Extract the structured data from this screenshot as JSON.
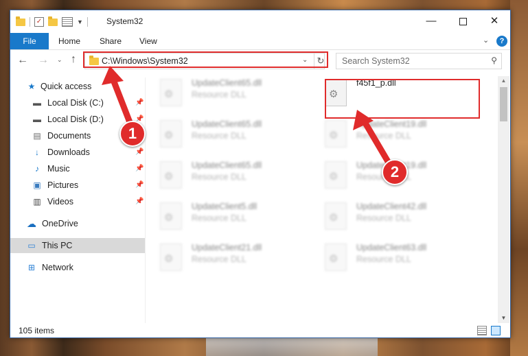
{
  "window": {
    "title": "System32",
    "controls": {
      "minimize": "—",
      "maximize": "",
      "close": "✕"
    }
  },
  "ribbon": {
    "tabs": [
      "File",
      "Home",
      "Share",
      "View"
    ],
    "help": "?"
  },
  "address": {
    "path": "C:\\Windows\\System32"
  },
  "search": {
    "placeholder": "Search System32"
  },
  "sidebar": {
    "items": [
      {
        "label": "Quick access",
        "icon": "star-icon",
        "pinned": false
      },
      {
        "label": "Local Disk (C:)",
        "icon": "drive-icon",
        "pinned": true
      },
      {
        "label": "Local Disk (D:)",
        "icon": "drive-icon",
        "pinned": true
      },
      {
        "label": "Documents",
        "icon": "documents-icon",
        "pinned": true
      },
      {
        "label": "Downloads",
        "icon": "download-icon",
        "pinned": true
      },
      {
        "label": "Music",
        "icon": "music-icon",
        "pinned": true
      },
      {
        "label": "Pictures",
        "icon": "pictures-icon",
        "pinned": true
      },
      {
        "label": "Videos",
        "icon": "videos-icon",
        "pinned": true
      },
      {
        "label": "OneDrive",
        "icon": "cloud-icon",
        "pinned": false
      },
      {
        "label": "This PC",
        "icon": "computer-icon",
        "pinned": false
      },
      {
        "label": "Network",
        "icon": "network-icon",
        "pinned": false
      }
    ]
  },
  "files": [
    {
      "name": "UpdateClient65.dll",
      "type": "Resource DLL"
    },
    {
      "name": "f45f1_p.dll",
      "type": ""
    },
    {
      "name": "UpdateClient65.dll",
      "type": "Resource DLL"
    },
    {
      "name": "UpdateClient19.dll",
      "type": "Resource DLL"
    },
    {
      "name": "UpdateClient65.dll",
      "type": "Resource DLL"
    },
    {
      "name": "UpdateClient19.dll",
      "type": "Resource DLL"
    },
    {
      "name": "UpdateClient5.dll",
      "type": "Resource DLL"
    },
    {
      "name": "UpdateClient42.dll",
      "type": "Resource DLL"
    },
    {
      "name": "UpdateClient21.dll",
      "type": "Resource DLL"
    },
    {
      "name": "UpdateClient63.dll",
      "type": "Resource DLL"
    }
  ],
  "status": {
    "item_count": "105 items"
  },
  "annotations": {
    "step1": "1",
    "step2": "2"
  },
  "colors": {
    "accent": "#1979ca",
    "highlight": "#e02b2b",
    "selected_bg": "#cde8ff"
  }
}
